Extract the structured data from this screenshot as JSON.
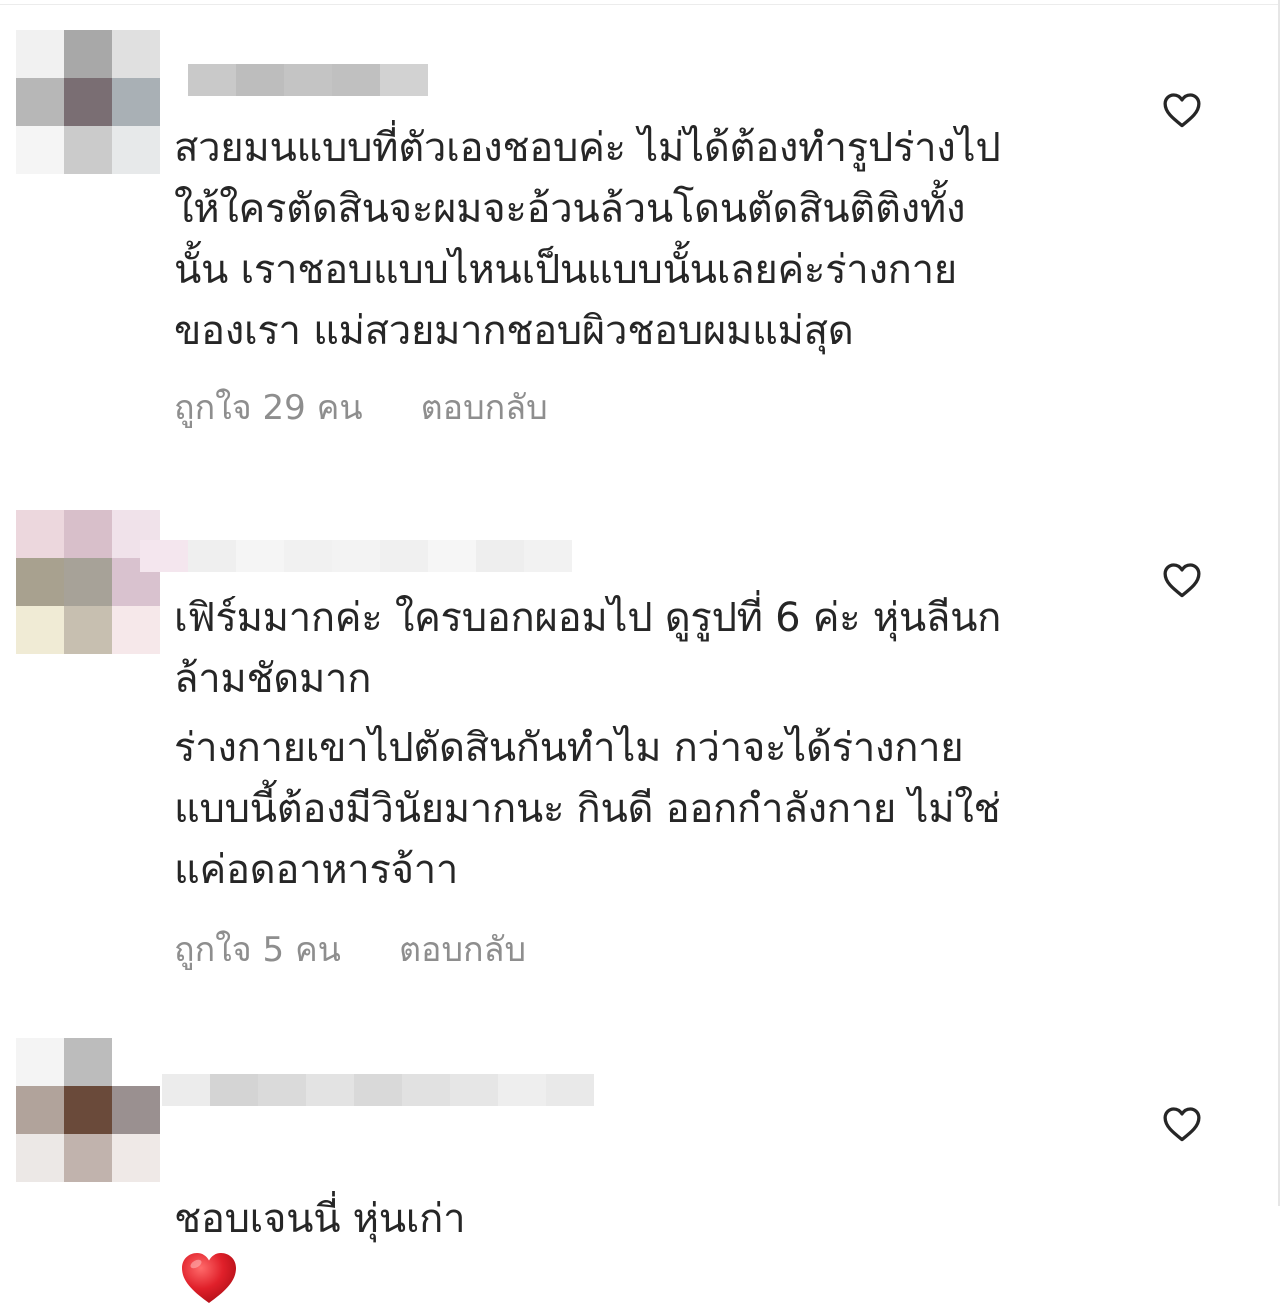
{
  "comments": [
    {
      "text": "สวยมนแบบที่ตัวเองชอบค่ะ ไม่ได้ต้องทำรูปร่างไป\nให้ใครตัดสินจะผมจะอ้วนล้วนโดนตัดสินติติงทั้ง\nนั้น เราชอบแบบไหนเป็นแบบนั้นเลยค่ะร่างกาย\nของเรา แม่สวยมากชอบผิวชอบผมแม่สุด",
      "likes_label": "ถูกใจ 29 คน",
      "reply_label": "ตอบกลับ",
      "avatar_colors": [
        "#f1f1f1",
        "#a8a8a8",
        "#e0e0e0",
        "#b7b7b7",
        "#7a6e73",
        "#a9b0b5",
        "#f5f5f5",
        "#cbcbcb",
        "#e7e9ea"
      ],
      "username_colors": [
        "#e8e8e8",
        "#dcdcdc",
        "#efefef",
        "#f3f3f3",
        "#e9e9e9",
        "#c9c9c9",
        "#bdbdbd",
        "#c4c4c4",
        "#c0c0c0",
        "#d2d2d2"
      ]
    },
    {
      "text": "เฟิร์มมากค่ะ ใครบอกผอมไป ดูรูปที่ 6 ค่ะ หุ่นลีนก\nล้ามชัดมาก",
      "text2": "ร่างกายเขาไปตัดสินกันทำไม กว่าจะได้ร่างกาย\nแบบนี้ต้องมีวินัยมากนะ กินดี ออกกำลังกาย ไม่ใช่\nแค่อดอาหารจ้าา",
      "likes_label": "ถูกใจ 5 คน",
      "reply_label": "ตอบกลับ",
      "avatar_colors": [
        "#ecd7dd",
        "#d8bfca",
        "#f0e2ea",
        "#a8a18f",
        "#a7a298",
        "#d9c2cf",
        "#f0ebd5",
        "#c7bfb0",
        "#f6e8ea"
      ],
      "username_colors": [
        "#f4e6ee",
        "#efefef",
        "#f5f5f5",
        "#f1f1f1",
        "#f3f3f3",
        "#f0f0f0",
        "#f6f6f6",
        "#eeeeee",
        "#f2f2f2",
        "#f7f7f7"
      ]
    },
    {
      "text": "ชอบเจนนี่ หุ่นเก่า",
      "avatar_colors": [
        "#f4f4f4",
        "#bcbcbc",
        "#ffffff",
        "#b1a39b",
        "#6a4a3a",
        "#9a9090",
        "#ece8e6",
        "#c1b3ad",
        "#efe9e7"
      ],
      "username_colors": [
        "#ececec",
        "#d4d4d4",
        "#dadada",
        "#e3e3e3",
        "#d9d9d9",
        "#e1e1e1",
        "#e6e6e6",
        "#eeeeee",
        "#e9e9e9",
        "#f0f0f0"
      ]
    }
  ],
  "icons": {
    "like": "heart-outline-icon",
    "emoji": "red-heart-emoji-icon"
  },
  "colors": {
    "text": "#262626",
    "meta": "#8e8e8e",
    "heart_emoji": "#e0202a"
  }
}
